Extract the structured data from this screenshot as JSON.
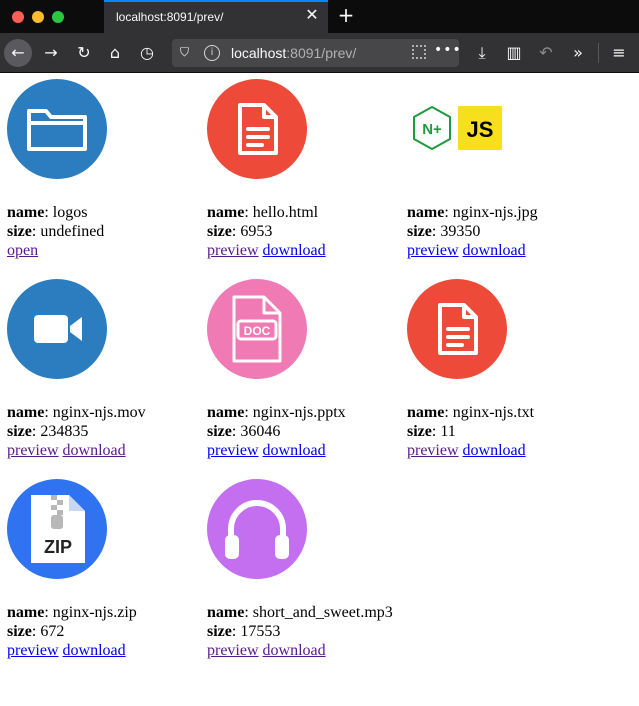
{
  "browser": {
    "tab_title": "localhost:8091/prev/",
    "url_host": "localhost",
    "url_rest": ":8091/prev/"
  },
  "labels": {
    "name": "name",
    "size": "size"
  },
  "files": [
    {
      "name": "logos",
      "size": "undefined",
      "icon": "folder-icon",
      "links": [
        "open"
      ]
    },
    {
      "name": "hello.html",
      "size": "6953",
      "icon": "document-icon",
      "links": [
        "preview",
        "download"
      ]
    },
    {
      "name": "nginx-njs.jpg",
      "size": "39350",
      "icon": "image-thumbnail",
      "links": [
        "preview",
        "download"
      ]
    },
    {
      "name": "nginx-njs.mov",
      "size": "234835",
      "icon": "video-icon",
      "links": [
        "preview",
        "download"
      ]
    },
    {
      "name": "nginx-njs.pptx",
      "size": "36046",
      "icon": "doc-file-icon",
      "links": [
        "preview",
        "download"
      ]
    },
    {
      "name": "nginx-njs.txt",
      "size": "11",
      "icon": "document-icon",
      "links": [
        "preview",
        "download"
      ]
    },
    {
      "name": "nginx-njs.zip",
      "size": "672",
      "icon": "zip-icon",
      "links": [
        "preview",
        "download"
      ]
    },
    {
      "name": "short_and_sweet.mp3",
      "size": "17553",
      "icon": "headphones-icon",
      "links": [
        "preview",
        "download"
      ]
    }
  ],
  "thumbnail_text": {
    "njs_logo_left": "N+",
    "njs_logo_right": "JS",
    "doc_label": "DOC",
    "zip_label": "ZIP"
  },
  "colors": {
    "folder_blue": "#2b7dc0",
    "doc_red": "#ee4a3a",
    "pptx_pink": "#ef7ab4",
    "zip_blue": "#2f73f0",
    "audio_purple": "#c46ef0",
    "js_yellow": "#f7df1e",
    "nginx_green": "#1e9a40"
  }
}
